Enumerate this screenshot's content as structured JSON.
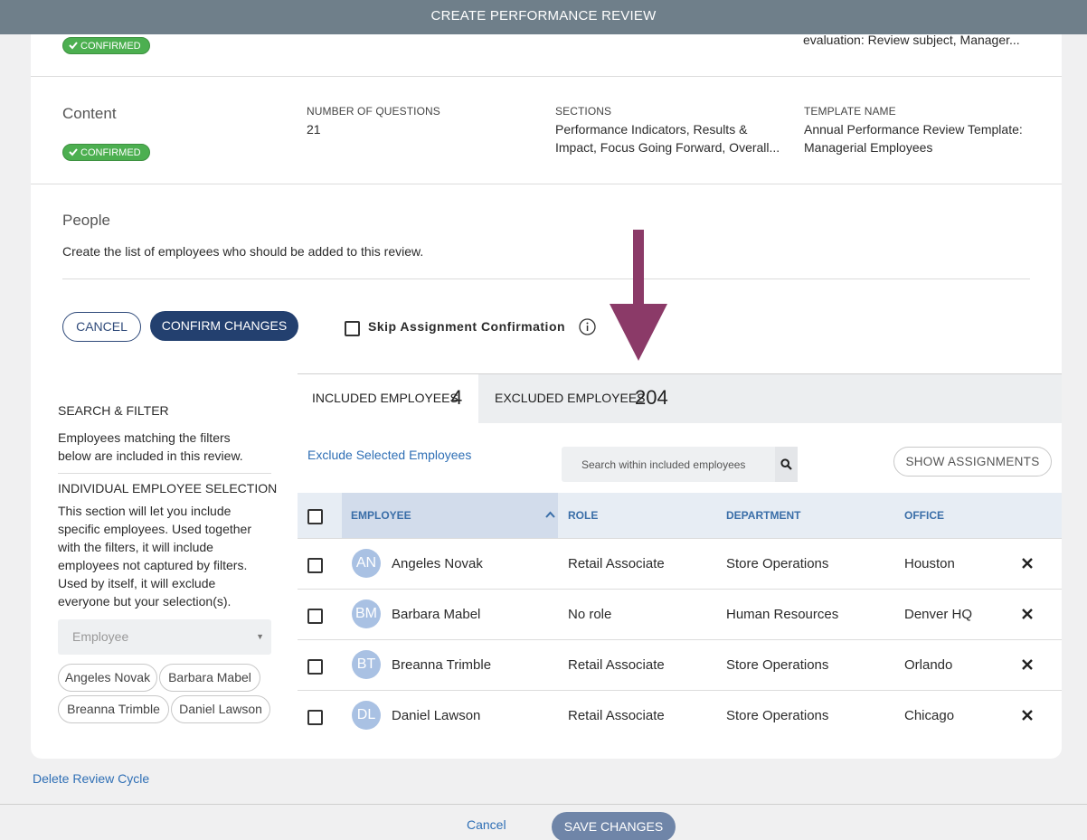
{
  "window": {
    "title": "CREATE PERFORMANCE REVIEW"
  },
  "top_section": {
    "badge": "CONFIRMED",
    "evaluation_text": "evaluation: Review subject, Manager..."
  },
  "content_section": {
    "title": "Content",
    "badge": "CONFIRMED",
    "num_questions_label": "NUMBER OF QUESTIONS",
    "num_questions_value": "21",
    "sections_label": "SECTIONS",
    "sections_value_line1": "Performance Indicators, Results &",
    "sections_value_line2": "Impact, Focus Going Forward, Overall...",
    "template_label": "TEMPLATE NAME",
    "template_value_line1": "Annual Performance Review Template:",
    "template_value_line2": "Managerial Employees"
  },
  "people_section": {
    "title": "People",
    "description": "Create the list of employees who should be added to this review.",
    "cancel_label": "CANCEL",
    "confirm_label": "CONFIRM CHANGES",
    "skip_label": "Skip Assignment Confirmation"
  },
  "filters": {
    "search_filter_heading": "SEARCH & FILTER",
    "search_filter_line1": "Employees matching the filters",
    "search_filter_line2": "below are included in this review.",
    "individual_heading": "INDIVIDUAL EMPLOYEE SELECTION",
    "individual_lines": [
      "This section will let you include",
      "specific employees. Used together",
      "with the filters, it will include",
      "employees not captured by filters.",
      "Used by itself, it will exclude",
      "everyone but your selection(s)."
    ],
    "employee_select_placeholder": "Employee",
    "selected_pills": [
      "Angeles Novak",
      "Barbara Mabel",
      "Breanna Trimble",
      "Daniel Lawson"
    ]
  },
  "tabs": [
    {
      "label": "INCLUDED EMPLOYEES",
      "count": "4"
    },
    {
      "label": "EXCLUDED EMPLOYEES",
      "count": "204"
    }
  ],
  "toolbar": {
    "exclude_link": "Exclude Selected Employees",
    "search_placeholder": "Search within included employees",
    "show_assignments_label": "SHOW ASSIGNMENTS"
  },
  "table": {
    "columns": [
      "EMPLOYEE",
      "ROLE",
      "DEPARTMENT",
      "OFFICE"
    ],
    "rows": [
      {
        "initials": "AN",
        "name": "Angeles Novak",
        "role": "Retail Associate",
        "department": "Store Operations",
        "office": "Houston"
      },
      {
        "initials": "BM",
        "name": "Barbara Mabel",
        "role": "No role",
        "department": "Human Resources",
        "office": "Denver HQ"
      },
      {
        "initials": "BT",
        "name": "Breanna Trimble",
        "role": "Retail Associate",
        "department": "Store Operations",
        "office": "Orlando"
      },
      {
        "initials": "DL",
        "name": "Daniel Lawson",
        "role": "Retail Associate",
        "department": "Store Operations",
        "office": "Chicago"
      }
    ]
  },
  "footer": {
    "delete_link": "Delete Review Cycle",
    "cancel_label": "Cancel",
    "save_label": "SAVE CHANGES"
  },
  "colors": {
    "accent": "#23406f",
    "confirmed_green": "#4caf50",
    "annotation_arrow": "#8b3a68"
  }
}
